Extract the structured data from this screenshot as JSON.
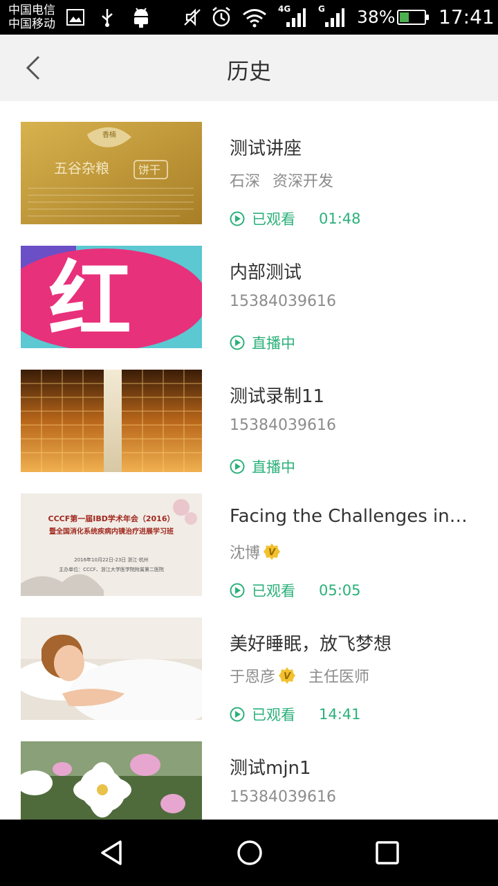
{
  "status_bar": {
    "carrier_1": "中国电信",
    "carrier_2": "中国移动",
    "net_1": "4G",
    "net_2": "G",
    "battery": "38%",
    "battery_level": 0.38,
    "time": "17:41"
  },
  "header": {
    "title": "历史"
  },
  "items": [
    {
      "title": "测试讲座",
      "subtitle": "石深",
      "subtitle_2": "资深开发",
      "status": "已观看",
      "duration": "01:48",
      "verified": false,
      "thumb": "biscuit"
    },
    {
      "title": "内部测试",
      "subtitle": "15384039616",
      "subtitle_2": "",
      "status": "直播中",
      "duration": "",
      "verified": false,
      "thumb": "red"
    },
    {
      "title": "测试录制11",
      "subtitle": "15384039616",
      "subtitle_2": "",
      "status": "直播中",
      "duration": "",
      "verified": false,
      "thumb": "buildings"
    },
    {
      "title": "Facing the Challenges in C...",
      "subtitle": "沈博",
      "subtitle_2": "",
      "status": "已观看",
      "duration": "05:05",
      "verified": true,
      "thumb": "conference"
    },
    {
      "title": "美好睡眠，放飞梦想",
      "subtitle": "于恩彦",
      "subtitle_2": "主任医师",
      "status": "已观看",
      "duration": "14:41",
      "verified": true,
      "thumb": "sleep"
    },
    {
      "title": "测试mjn1",
      "subtitle": "15384039616",
      "subtitle_2": "",
      "status": "",
      "duration": "",
      "verified": false,
      "thumb": "flowers"
    }
  ],
  "thumb_text": {
    "biscuit_brand": "五谷杂粮",
    "biscuit_tag": "饼干",
    "biscuit_leaf": "香楠",
    "red_big": "红",
    "conf_line1": "CCCF第一届IBD学术年会（2016）",
    "conf_line2": "暨全国消化系统疾病内镜治疗进展学习班",
    "conf_line3": "2016年10月22日-23日  浙江·杭州",
    "conf_line4": "主办单位：CCCF、浙江大学医学院附属第二医院"
  },
  "colors": {
    "accent": "#2bb07a",
    "header_bg": "#f2f2f2",
    "title": "#333333",
    "subtitle": "#8c8c8c"
  }
}
